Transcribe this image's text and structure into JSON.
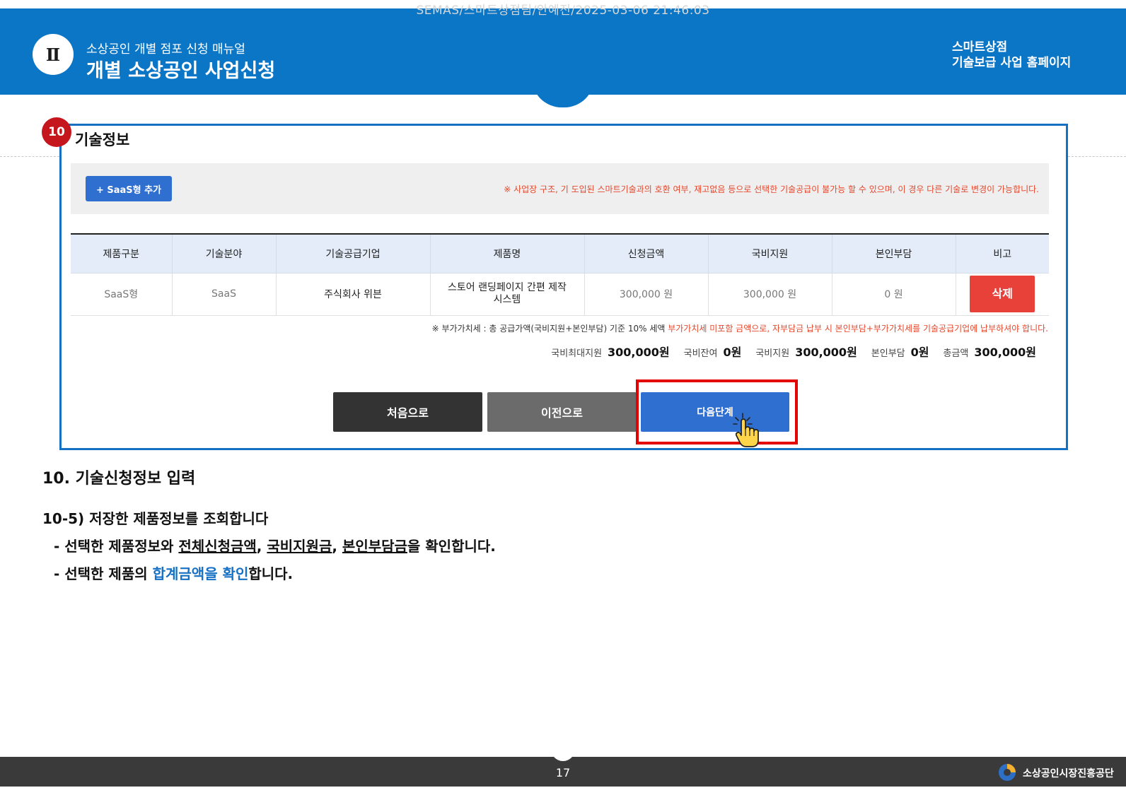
{
  "watermark": "SEMAS/스마트상점팀/안예진/2025-03-06 21:46:03",
  "header": {
    "roman": "Ⅱ",
    "subtitle": "소상공인 개별 점포 신청 매뉴얼",
    "title": "개별 소상공인 사업신청",
    "right_line1": "스마트상점",
    "right_line2": "기술보급 사업 홈페이지",
    "color": "#0c76c6"
  },
  "screen": {
    "step_number": "10",
    "section_title": "기술정보",
    "add_button": "+ SaaS형 추가",
    "warning": "※ 사업장 구조, 기 도입된 스마트기술과의 호환 여부, 재고없음 등으로 선택한 기술공급이 불가능 할 수 있으며, 이 경우 다른 기술로 변경이 가능합니다.",
    "columns": [
      "제품구분",
      "기술분야",
      "기술공급기업",
      "제품명",
      "신청금액",
      "국비지원",
      "본인부담",
      "비고"
    ],
    "rows": [
      {
        "category": "SaaS형",
        "field": "SaaS",
        "supplier": "주식회사 위븐",
        "product_line1": "스토어 랜딩페이지 간편 제작",
        "product_line2": "시스템",
        "requested": "300,000 원",
        "subsidy": "300,000 원",
        "self_pay": "0 원",
        "action": "삭제"
      }
    ],
    "vat_note_prefix": "※ 부가가치세 : 총 공급가액(국비지원+본인부담) 기준 10% 세액 ",
    "vat_note_highlight": "부가가치세 미포함 금액으로, 자부담금 납부 시 본인부담+부가가치세를 기술공급기업에 납부하셔야 합니다.",
    "totals": [
      {
        "label": "국비최대지원",
        "value": "300,000원"
      },
      {
        "label": "국비잔여",
        "value": "0원"
      },
      {
        "label": "국비지원",
        "value": "300,000원"
      },
      {
        "label": "본인부담",
        "value": "0원"
      },
      {
        "label": "총금액",
        "value": "300,000원"
      }
    ],
    "buttons": {
      "first": "처음으로",
      "prev": "이전으로",
      "next": "다음단계"
    },
    "highlight_color": "#e50000"
  },
  "doc": {
    "heading": "10. 기술신청정보 입력",
    "subheading": "10-5) 저장한 제품정보를 조회합니다",
    "line1": {
      "prefix": "- 선택한 제품정보와 ",
      "u1": "전체신청금액",
      "sep1": ", ",
      "u2": "국비지원금",
      "sep2": ", ",
      "u3": "본인부담금",
      "suffix": "을 확인합니다."
    },
    "line2": {
      "prefix": "- 선택한 제품의 ",
      "blue": "합계금액을 확인",
      "suffix": "합니다."
    }
  },
  "footer": {
    "page_number": "17",
    "org": "소상공인시장진흥공단"
  }
}
